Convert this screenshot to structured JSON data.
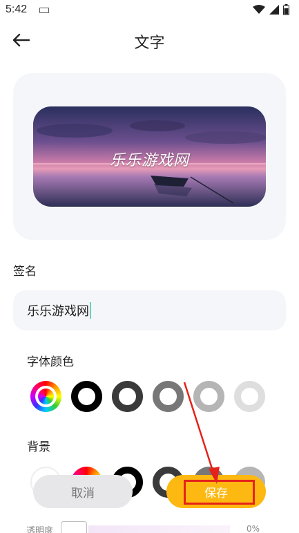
{
  "status": {
    "time": "5:42"
  },
  "header": {
    "title": "文字"
  },
  "preview": {
    "text": "乐乐游戏网"
  },
  "signature": {
    "label": "签名",
    "value": "乐乐游戏网"
  },
  "font_color": {
    "label": "字体颜色",
    "options": [
      "rainbow",
      "#000000",
      "#3a3a3a",
      "#777777",
      "#b5b5b5",
      "#dedede"
    ]
  },
  "background": {
    "label": "背景",
    "options": [
      "#ffffff",
      "rainbow",
      "#000000",
      "#3a3a3a",
      "#777777",
      "#b5b5b5"
    ]
  },
  "actions": {
    "cancel_label": "取消",
    "save_label": "保存"
  },
  "opacity": {
    "label": "透明度",
    "value": "0%"
  },
  "colors": {
    "accent": "#fdb811",
    "highlight": "#e5221a",
    "card_bg": "#f5f6fa"
  }
}
